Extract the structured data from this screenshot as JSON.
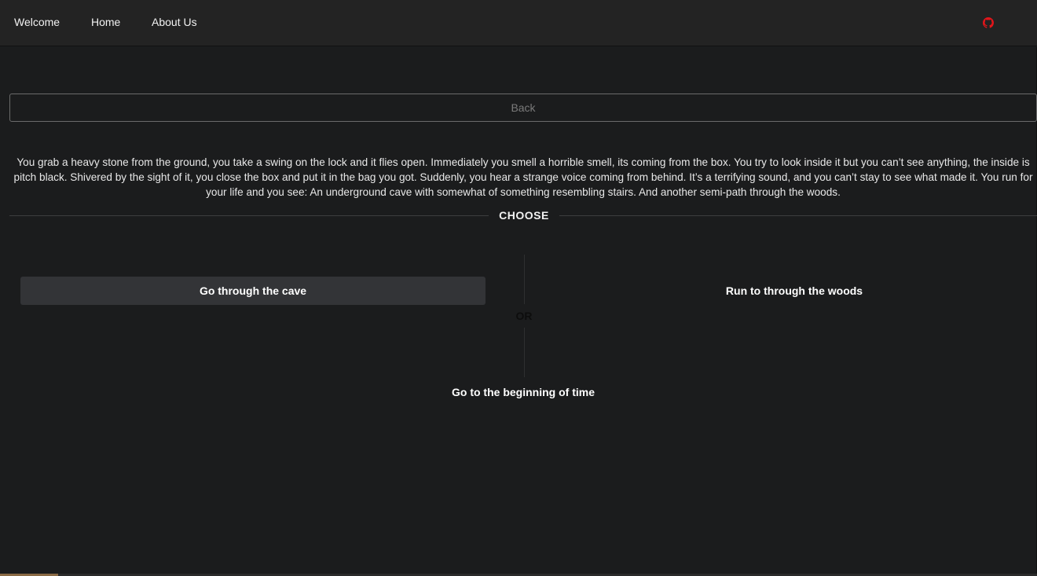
{
  "nav": {
    "items": [
      "Welcome",
      "Home",
      "About Us"
    ],
    "github_icon": "github-icon",
    "github_color": "#e3151a"
  },
  "back_label": "Back",
  "story": "You grab a heavy stone from the ground, you take a swing on the lock and it flies open. Immediately you smell a horrible smell, its coming from the box. You try to look inside it but you can’t see anything, the inside is pitch black. Shivered by the sight of it, you close the box and put it in the bag you got. Suddenly, you hear a strange voice coming from behind. It’s a terrifying sound, and you can’t stay to see what made it. You run for your life and you see: An underground cave with somewhat of something resembling stairs. And another semi-path through the woods.",
  "choose_label": "CHOOSE",
  "or_label": "OR",
  "options": [
    "Go through the cave",
    "Run to through the woods",
    "Go to the beginning of time"
  ],
  "colors": {
    "background": "#1b1c1d",
    "navbar": "#232323",
    "active_option": "#333437"
  }
}
